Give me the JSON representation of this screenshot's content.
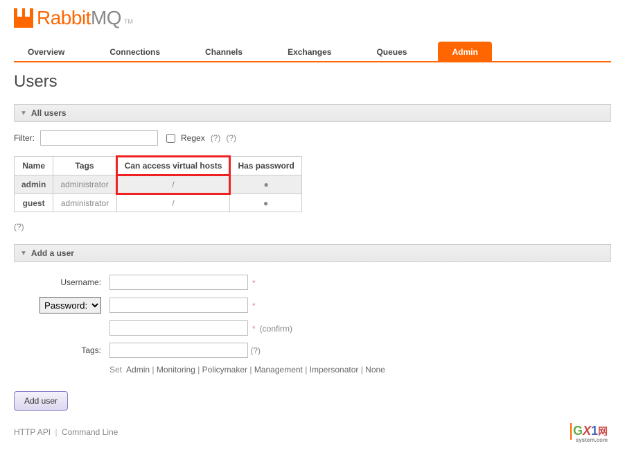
{
  "logo": {
    "text1": "Rabbit",
    "text2": "MQ",
    "tm": "TM"
  },
  "nav": {
    "items": [
      "Overview",
      "Connections",
      "Channels",
      "Exchanges",
      "Queues",
      "Admin"
    ],
    "active": "Admin"
  },
  "page_title": "Users",
  "sections": {
    "all_users": "All users",
    "add_user": "Add a user"
  },
  "filter": {
    "label": "Filter:",
    "regex_label": "Regex",
    "help1": "(?)",
    "help2": "(?)"
  },
  "users_table": {
    "headers": [
      "Name",
      "Tags",
      "Can access virtual hosts",
      "Has password"
    ],
    "rows": [
      {
        "name": "admin",
        "tags": "administrator",
        "vhosts": "/",
        "password": "●"
      },
      {
        "name": "guest",
        "tags": "administrator",
        "vhosts": "/",
        "password": "●"
      }
    ]
  },
  "table_help": "(?)",
  "add_user_form": {
    "username_label": "Username:",
    "password_select": "Password:",
    "confirm_text": "(confirm)",
    "tags_label": "Tags:",
    "tags_help": "(?)",
    "set_label": "Set",
    "tag_options": [
      "Admin",
      "Monitoring",
      "Policymaker",
      "Management",
      "Impersonator",
      "None"
    ],
    "button": "Add user"
  },
  "footer": {
    "api": "HTTP API",
    "cli": "Command Line"
  },
  "watermark": {
    "g": "G",
    "x": "X",
    "one": "1",
    "wang": "网",
    "sys": "system.com"
  }
}
